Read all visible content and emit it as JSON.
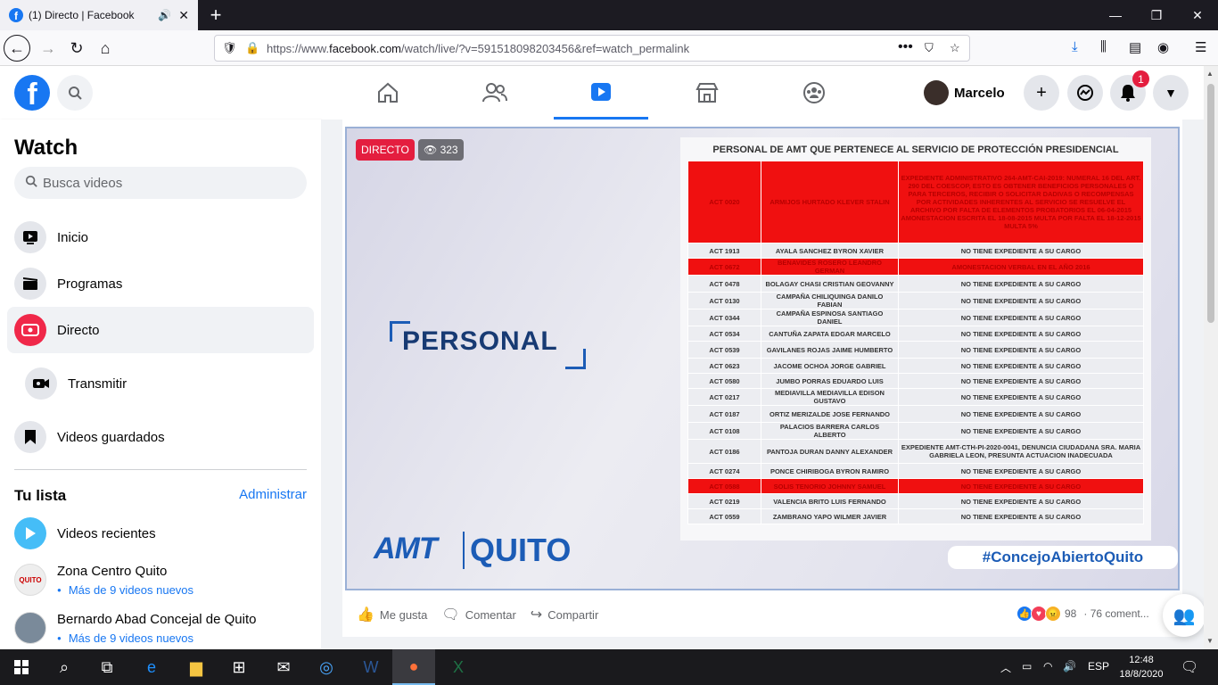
{
  "browser": {
    "tab_title": "(1) Directo | Facebook",
    "url_prefix": "https://www.",
    "url_domain": "facebook.com",
    "url_rest": "/watch/live/?v=591518098203456&ref=watch_permalink"
  },
  "header": {
    "user_name": "Marcelo",
    "notif_count": "1"
  },
  "sidebar": {
    "title": "Watch",
    "search_placeholder": "Busca videos",
    "items": [
      {
        "label": "Inicio"
      },
      {
        "label": "Programas"
      },
      {
        "label": "Directo"
      },
      {
        "label": "Transmitir"
      },
      {
        "label": "Videos guardados"
      }
    ],
    "list_title": "Tu lista",
    "admin_label": "Administrar",
    "recent_label": "Videos recientes",
    "pages": [
      {
        "name": "Zona Centro Quito",
        "sub": "Más de 9 videos nuevos",
        "avatar_text": "QUITO"
      },
      {
        "name": "Bernardo Abad Concejal de Quito",
        "sub": "Más de 9 videos nuevos",
        "avatar_text": ""
      }
    ]
  },
  "video": {
    "live_badge": "DIRECTO",
    "viewers": "323",
    "personal_label": "PERSONAL",
    "amt_logo": "AMT",
    "quito_logo": "QUITO",
    "hashtag": "#ConcejoAbiertoQuito",
    "doc_title": "PERSONAL DE AMT QUE PERTENECE AL SERVICIO DE PROTECCIÓN PRESIDENCIAL",
    "rows": [
      {
        "code": "ACT 0020",
        "name": "ARMIJOS HURTADO KLEVER STALIN",
        "note": "EXPEDIENTE ADMINISTRATIVO 264-AMT-CAI-2019: NUMERAL 16 DEL ART. 290 DEL COESCOP, ESTO ES OBTENER BENEFICIOS PERSONALES O PARA TERCEROS, RECIBIR O SOLICITAR DADIVAS O RECOMPENSAS POR ACTIVIDADES INHERENTES AL SERVICIO SE RESUELVE EL ARCHIVO POR FALTA DE ELEMENTOS PROBATORIOS EL 06-04-2015 AMONESTACION ESCRITA EL 18-08-2015 MULTA POR FALTA EL 18-12-2015 MULTA 5%",
        "red": true
      },
      {
        "code": "ACT 1913",
        "name": "AYALA SANCHEZ BYRON XAVIER",
        "note": "NO TIENE EXPEDIENTE A SU CARGO",
        "red": false
      },
      {
        "code": "ACT 0672",
        "name": "BENAVIDES ROSERO LEANDRO GERMAN",
        "note": "AMONESTACION VERBAL EN EL AÑO 2016",
        "red": true
      },
      {
        "code": "ACT 0478",
        "name": "BOLAGAY CHASI CRISTIAN GEOVANNY",
        "note": "NO TIENE EXPEDIENTE A SU CARGO",
        "red": false
      },
      {
        "code": "ACT 0130",
        "name": "CAMPAÑA CHILIQUINGA DANILO FABIAN",
        "note": "NO TIENE EXPEDIENTE A SU CARGO",
        "red": false
      },
      {
        "code": "ACT 0344",
        "name": "CAMPAÑA ESPINOSA SANTIAGO DANIEL",
        "note": "NO TIENE EXPEDIENTE A SU CARGO",
        "red": false
      },
      {
        "code": "ACT 0534",
        "name": "CANTUÑA ZAPATA EDGAR MARCELO",
        "note": "NO TIENE EXPEDIENTE A SU CARGO",
        "red": false
      },
      {
        "code": "ACT 0539",
        "name": "GAVILANES ROJAS JAIME HUMBERTO",
        "note": "NO TIENE EXPEDIENTE A SU CARGO",
        "red": false
      },
      {
        "code": "ACT 0623",
        "name": "JACOME OCHOA JORGE GABRIEL",
        "note": "NO TIENE EXPEDIENTE A SU CARGO",
        "red": false
      },
      {
        "code": "ACT 0580",
        "name": "JUMBO PORRAS EDUARDO LUIS",
        "note": "NO TIENE EXPEDIENTE A SU CARGO",
        "red": false
      },
      {
        "code": "ACT 0217",
        "name": "MEDIAVILLA MEDIAVILLA EDISON GUSTAVO",
        "note": "NO TIENE EXPEDIENTE A SU CARGO",
        "red": false
      },
      {
        "code": "ACT 0187",
        "name": "ORTIZ MERIZALDE JOSE FERNANDO",
        "note": "NO TIENE EXPEDIENTE A SU CARGO",
        "red": false
      },
      {
        "code": "ACT 0108",
        "name": "PALACIOS BARRERA CARLOS ALBERTO",
        "note": "NO TIENE EXPEDIENTE A SU CARGO",
        "red": false
      },
      {
        "code": "ACT 0186",
        "name": "PANTOJA DURAN DANNY ALEXANDER",
        "note": "EXPEDIENTE AMT-CTH-PI-2020-0041, DENUNCIA CIUDADANA SRA. MARIA GABRIELA LEON, PRESUNTA ACTUACION INADECUADA",
        "red": false
      },
      {
        "code": "ACT 0274",
        "name": "PONCE CHIRIBOGA BYRON RAMIRO",
        "note": "NO TIENE EXPEDIENTE A SU CARGO",
        "red": false
      },
      {
        "code": "ACT 0588",
        "name": "SOLIS TENORIO JOHNNY SAMUEL",
        "note": "NO TIENE EXPEDIENTE A SU CARGO",
        "red": true
      },
      {
        "code": "ACT 0219",
        "name": "VALENCIA BRITO LUIS FERNANDO",
        "note": "NO TIENE EXPEDIENTE A SU CARGO",
        "red": false
      },
      {
        "code": "ACT 0559",
        "name": "ZAMBRANO YAPO WILMER JAVIER",
        "note": "NO TIENE EXPEDIENTE A SU CARGO",
        "red": false
      }
    ]
  },
  "actions": {
    "like": "Me gusta",
    "comment": "Comentar",
    "share": "Compartir",
    "reactions_count": "98",
    "comments_count": "· 76 coment..."
  },
  "taskbar": {
    "lang": "ESP",
    "time": "12:48",
    "date": "18/8/2020"
  }
}
